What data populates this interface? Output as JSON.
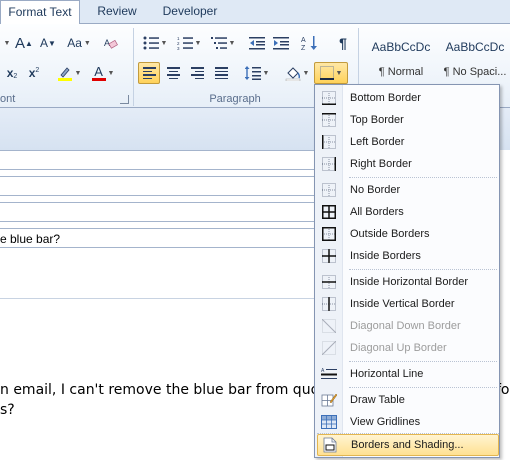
{
  "tabs": [
    "Format Text",
    "Review",
    "Developer"
  ],
  "ribbon": {
    "groups": {
      "font": "ont",
      "paragraph": "Paragraph"
    },
    "font_buttons": {
      "grow": "A",
      "shrink": "A",
      "case": "Aa",
      "subscript": "x",
      "superscript": "x",
      "font_color": "A"
    },
    "styles": [
      {
        "sample": "AaBbCcDc",
        "name": "¶ Normal"
      },
      {
        "sample": "AaBbCcDc",
        "name": "¶ No Spaci..."
      }
    ],
    "pilcrow": "¶"
  },
  "document": {
    "subject_fragment": "e blue bar?",
    "body_line1": "n email, I can't remove the blue bar from quoted tex",
    "body_line1_right": "fo",
    "body_line2": "s?"
  },
  "menu": {
    "items": [
      {
        "label": "Bottom Border",
        "icon": "bottom-border-icon",
        "disabled": false
      },
      {
        "label": "Top Border",
        "icon": "top-border-icon",
        "disabled": false
      },
      {
        "label": "Left Border",
        "icon": "left-border-icon",
        "disabled": false
      },
      {
        "label": "Right Border",
        "icon": "right-border-icon",
        "disabled": false
      },
      {
        "label": "No Border",
        "icon": "no-border-icon",
        "disabled": false
      },
      {
        "label": "All Borders",
        "icon": "all-borders-icon",
        "disabled": false
      },
      {
        "label": "Outside Borders",
        "icon": "outside-borders-icon",
        "disabled": false
      },
      {
        "label": "Inside Borders",
        "icon": "inside-borders-icon",
        "disabled": false
      },
      {
        "label": "Inside Horizontal Border",
        "icon": "inside-horizontal-border-icon",
        "disabled": false
      },
      {
        "label": "Inside Vertical Border",
        "icon": "inside-vertical-border-icon",
        "disabled": false
      },
      {
        "label": "Diagonal Down Border",
        "icon": "diagonal-down-border-icon",
        "disabled": true
      },
      {
        "label": "Diagonal Up Border",
        "icon": "diagonal-up-border-icon",
        "disabled": true
      },
      {
        "label": "Horizontal Line",
        "icon": "horizontal-line-icon",
        "disabled": false
      },
      {
        "label": "Draw Table",
        "icon": "draw-table-icon",
        "disabled": false
      },
      {
        "label": "View Gridlines",
        "icon": "view-gridlines-icon",
        "disabled": false
      },
      {
        "label": "Borders and Shading...",
        "icon": "borders-and-shading-icon",
        "disabled": false,
        "highlighted": true
      }
    ]
  },
  "colors": {
    "highlight_yellow": "#ffff00",
    "font_red": "#e00000",
    "selected": "#ffd25a",
    "menu_hover": "#ffe192"
  }
}
